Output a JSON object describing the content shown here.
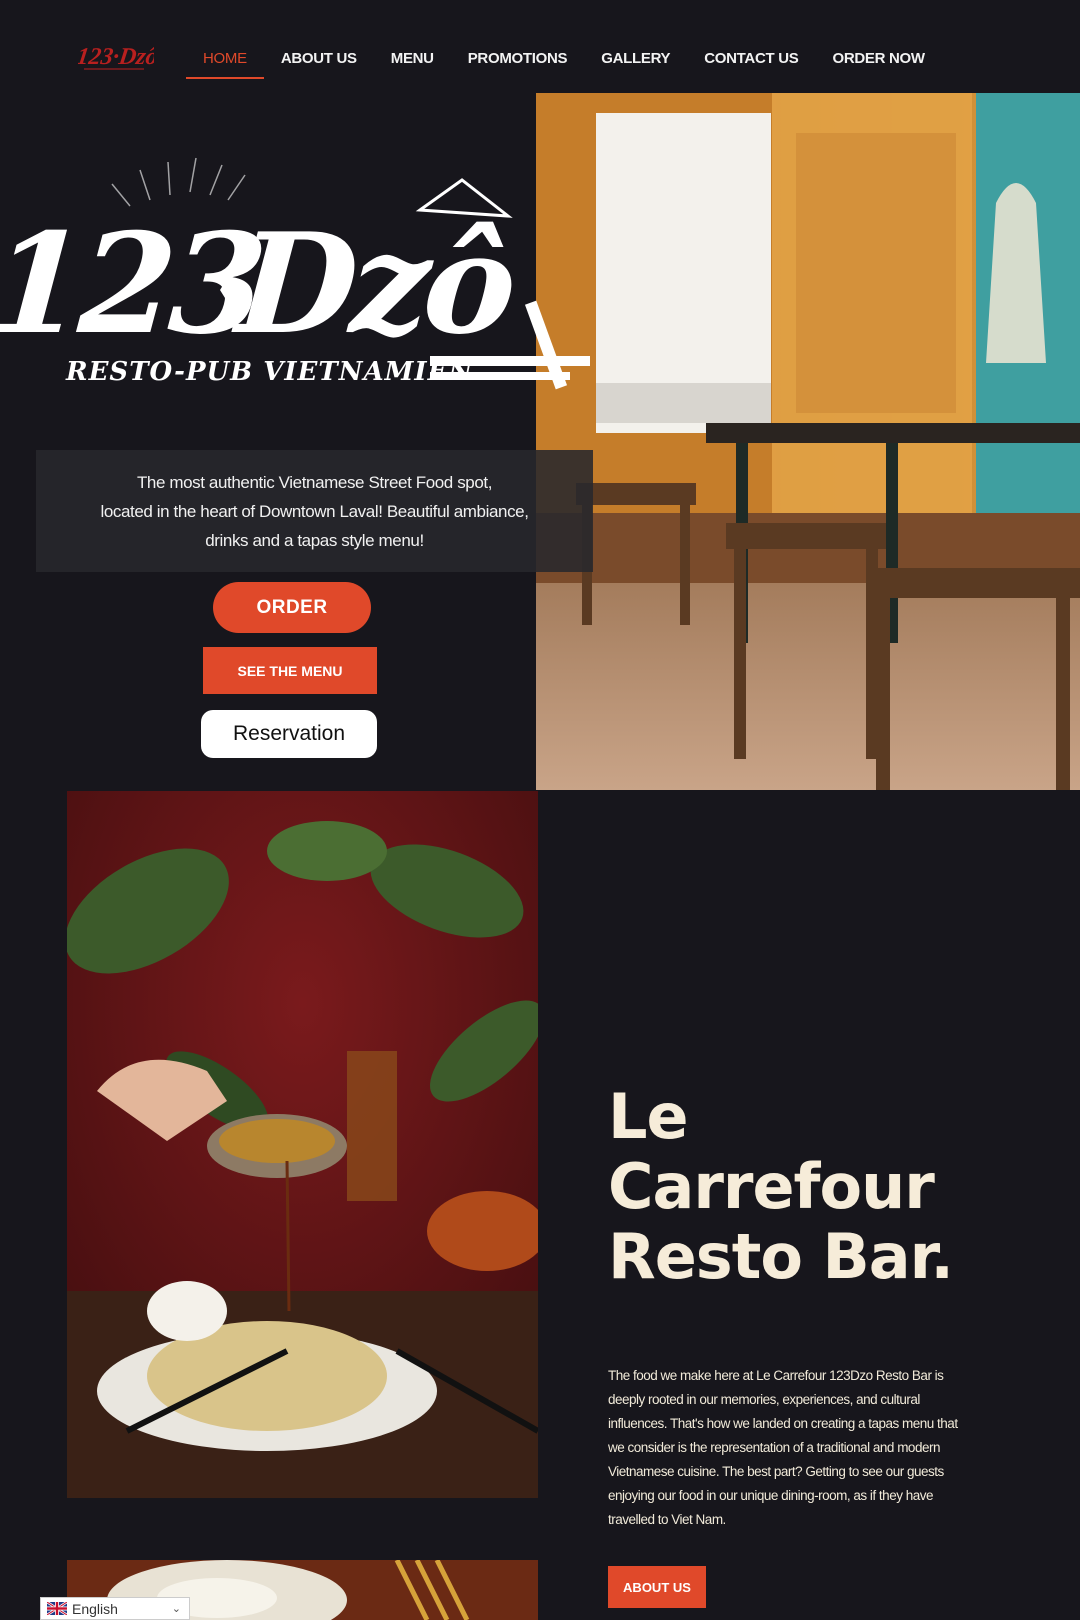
{
  "brand": {
    "logo_text": "123·Dzô",
    "tagline": "Resto-Pub Vietnamien"
  },
  "nav": {
    "items": [
      {
        "label": "HOME",
        "active": true
      },
      {
        "label": "ABOUT US"
      },
      {
        "label": "MENU"
      },
      {
        "label": "PROMOTIONS"
      },
      {
        "label": "GALLERY"
      },
      {
        "label": "CONTACT US"
      },
      {
        "label": "ORDER NOW"
      }
    ]
  },
  "hero": {
    "intro_line1": "The most authentic Vietnamese Street Food spot,",
    "intro_line2": "located in the heart of Downtown Laval! Beautiful ambiance,",
    "intro_line3": "drinks and a tapas style menu!",
    "order_label": "ORDER",
    "menu_label": "SEE THE MENU",
    "reservation_label": "Reservation"
  },
  "about": {
    "heading_line1": "Le",
    "heading_line2": "Carrefour",
    "heading_line3": "Resto Bar.",
    "body": "The food we make here at Le Carrefour 123Dzo Resto Bar is deeply rooted in our memories, experiences, and cultural influences. That's how we landed on creating a tapas menu that we consider is the representation of a traditional and modern Vietnamese cuisine. The best part? Getting to see our guests enjoying our food in our unique dining-room, as if they have travelled to Viet Nam.",
    "button_label": "ABOUT US"
  },
  "language": {
    "selected": "English",
    "icon": "uk-flag-icon"
  },
  "colors": {
    "background": "#17161c",
    "accent": "#e0492a",
    "heading": "#f6ecd9"
  }
}
